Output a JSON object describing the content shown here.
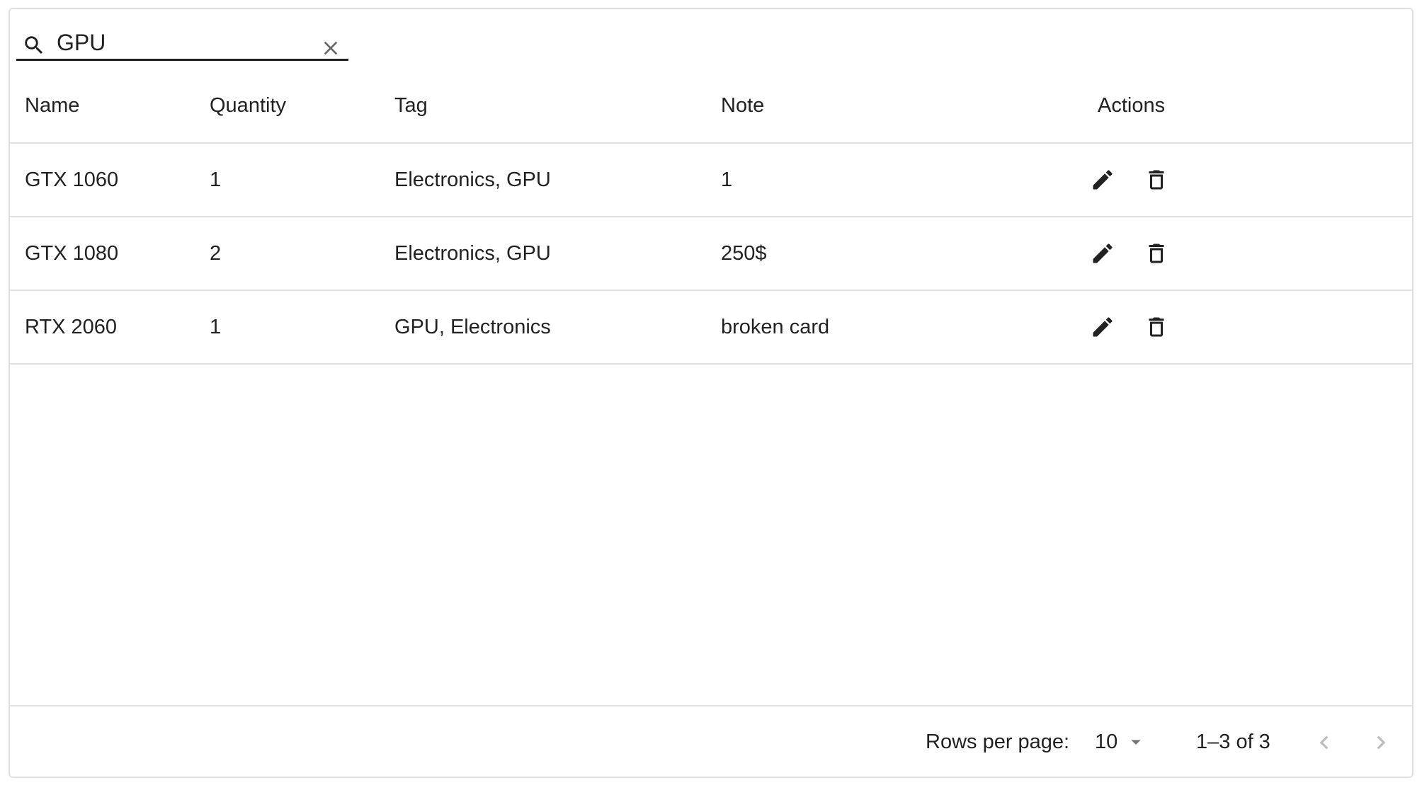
{
  "search": {
    "value": "GPU",
    "icon": "search-icon",
    "clear_icon": "close-icon"
  },
  "table": {
    "columns": [
      "Name",
      "Quantity",
      "Tag",
      "Note",
      "Actions"
    ],
    "rows": [
      {
        "name": "GTX 1060",
        "quantity": "1",
        "tag": "Electronics, GPU",
        "note": "1"
      },
      {
        "name": "GTX 1080",
        "quantity": "2",
        "tag": "Electronics, GPU",
        "note": "250$"
      },
      {
        "name": "RTX 2060",
        "quantity": "1",
        "tag": "GPU, Electronics",
        "note": "broken card"
      }
    ],
    "action_icons": [
      "edit-icon",
      "delete-icon"
    ]
  },
  "footer": {
    "rows_per_page_label": "Rows per page:",
    "rows_per_page_value": "10",
    "page_info": "1–3 of 3"
  },
  "colors": {
    "text": "#212121",
    "border": "#e0e0e0",
    "disabled_icon": "#bdbdbd"
  }
}
